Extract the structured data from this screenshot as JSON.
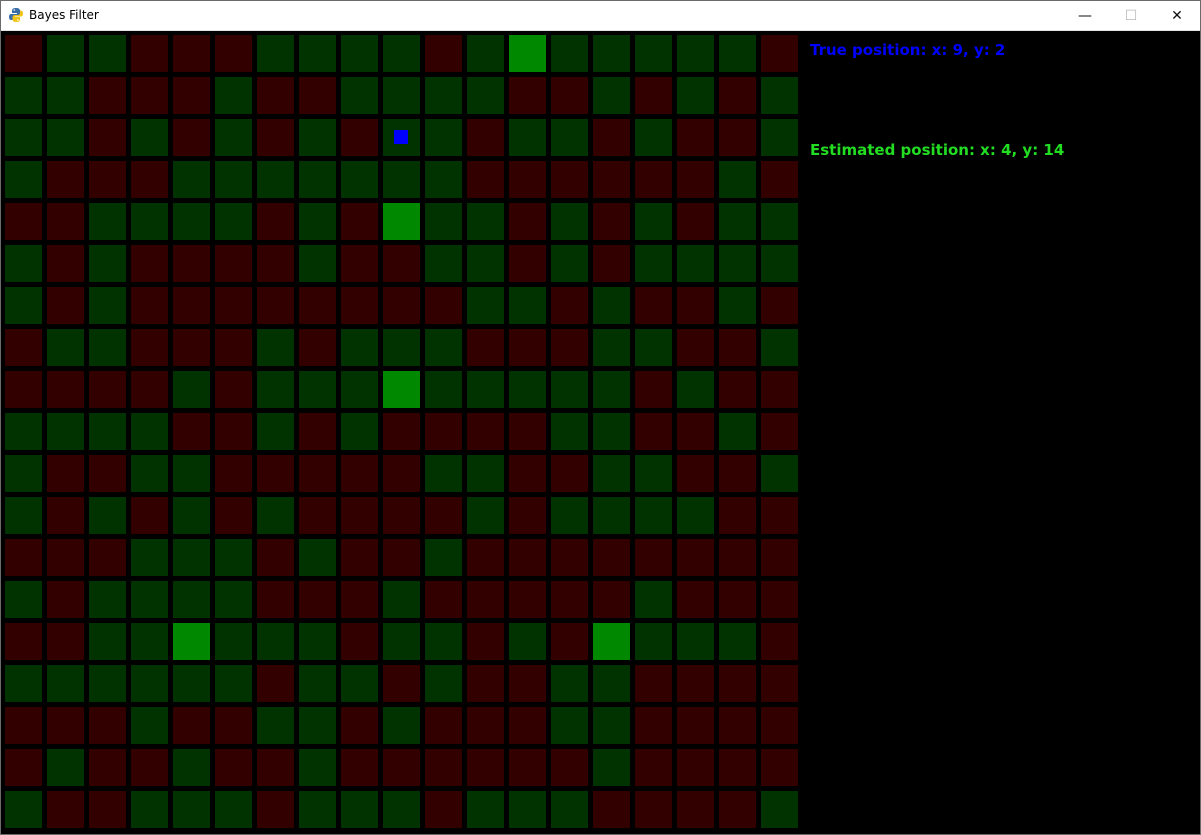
{
  "window": {
    "title": "Bayes Filter",
    "minimize_glyph": "—",
    "maximize_glyph": "☐",
    "close_glyph": "✕",
    "app_icon": "python-icon"
  },
  "colors": {
    "green_dark": "#003300",
    "red_dark": "#330000",
    "landmark_green": "#008800",
    "robot_blue": "#0000ff",
    "true_text": "#0000ff",
    "est_text": "#22dd22"
  },
  "grid": {
    "cols": 19,
    "rows": 19,
    "map": [
      "RGGRRRGGGGRGLGGGGGR",
      "GGRRRGRRGGGGRRGRGRG",
      "GGRGRGRGRGGRGGRGRRG",
      "GRRRGGGGGGGRRRRRRGR",
      "RRGGGGRGRLGGRGRGRGG",
      "GRGRRRRGRRGGRGRGGGG",
      "GRGRRRRRRRRGGRGRRGR",
      "RGGRRRGRGGGRRRGGRRG",
      "RRRRGRGGGLGGGGGRGRR",
      "GGGGRRGRGRRRRGGRRGR",
      "GRRGGRRRRRGGRRGGRRG",
      "GRGRGRGRRRRGRGGGGRR",
      "RRRGGGRGRRGRRRRRRRR",
      "GRGGGGRRRGRRRRRGRRR",
      "RRGGLGGGRGGRGRLGGGR",
      "GGGGGGRGGRGRRGGRRRR",
      "RRRGRRGGRGRRRGGRRRR",
      "RGRRGRRGRRRRRRGRRRR",
      "GRRGGGRGGGRGGGRRRRG"
    ],
    "robot": {
      "x": 9,
      "y": 2
    }
  },
  "readouts": {
    "true_position": "True position: x: 9, y: 2",
    "estimated_position": "Estimated position: x: 4, y: 14"
  }
}
